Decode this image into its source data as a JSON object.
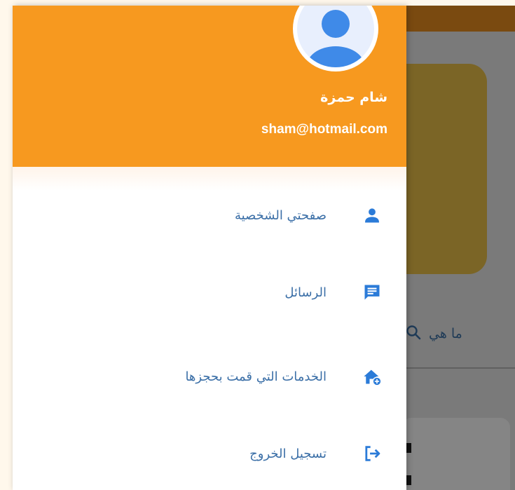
{
  "user": {
    "name": "شام حمزة",
    "email": "sham@hotmail.com"
  },
  "menu": {
    "items": [
      {
        "label": "صفحتي الشخصية",
        "icon": "person-icon"
      },
      {
        "label": "الرسائل",
        "icon": "message-icon"
      },
      {
        "label": "الخدمات التي قمت بحجزها",
        "icon": "home-add-icon"
      },
      {
        "label": "تسجيل الخروج",
        "icon": "logout-icon"
      }
    ]
  },
  "background": {
    "search_text": "ما هي"
  },
  "colors": {
    "header": "#f7991f",
    "menu_text": "#3b6fa7",
    "menu_icon": "#2b7bd8"
  }
}
